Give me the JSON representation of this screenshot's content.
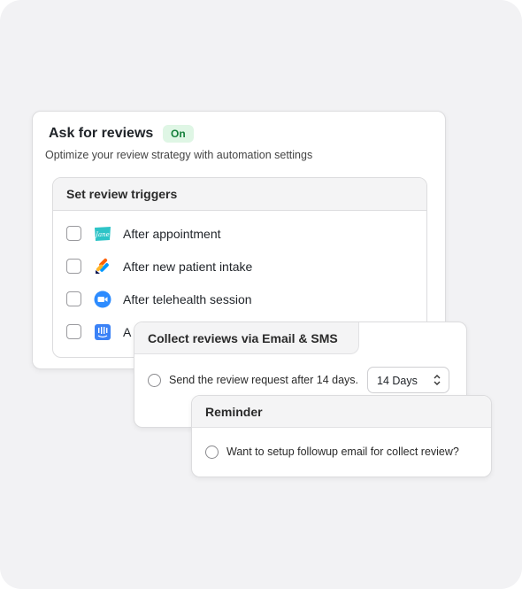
{
  "ask_reviews": {
    "title": "Ask for reviews",
    "status_badge": "On",
    "subtitle": "Optimize your review strategy with automation settings"
  },
  "triggers": {
    "title": "Set review triggers",
    "items": [
      {
        "label": "After appointment",
        "icon": "jane-app-icon",
        "checked": false
      },
      {
        "label": "After new patient intake",
        "icon": "jotform-icon",
        "checked": false
      },
      {
        "label": "After telehealth session",
        "icon": "zoom-icon",
        "checked": false
      },
      {
        "label": "A",
        "icon": "intercom-icon",
        "checked": false
      }
    ]
  },
  "collect": {
    "title": "Collect reviews via Email & SMS",
    "option_label": "Send the review request after 14 days.",
    "select_value": "14 Days"
  },
  "reminder": {
    "title": "Reminder",
    "option_label": "Want to setup followup email for collect review?"
  },
  "colors": {
    "badge_bg": "#dff6e5",
    "badge_text": "#16803c",
    "jane_teal": "#2ec4c7",
    "zoom_blue": "#2d8cff",
    "intercom_blue": "#3b82f6"
  }
}
